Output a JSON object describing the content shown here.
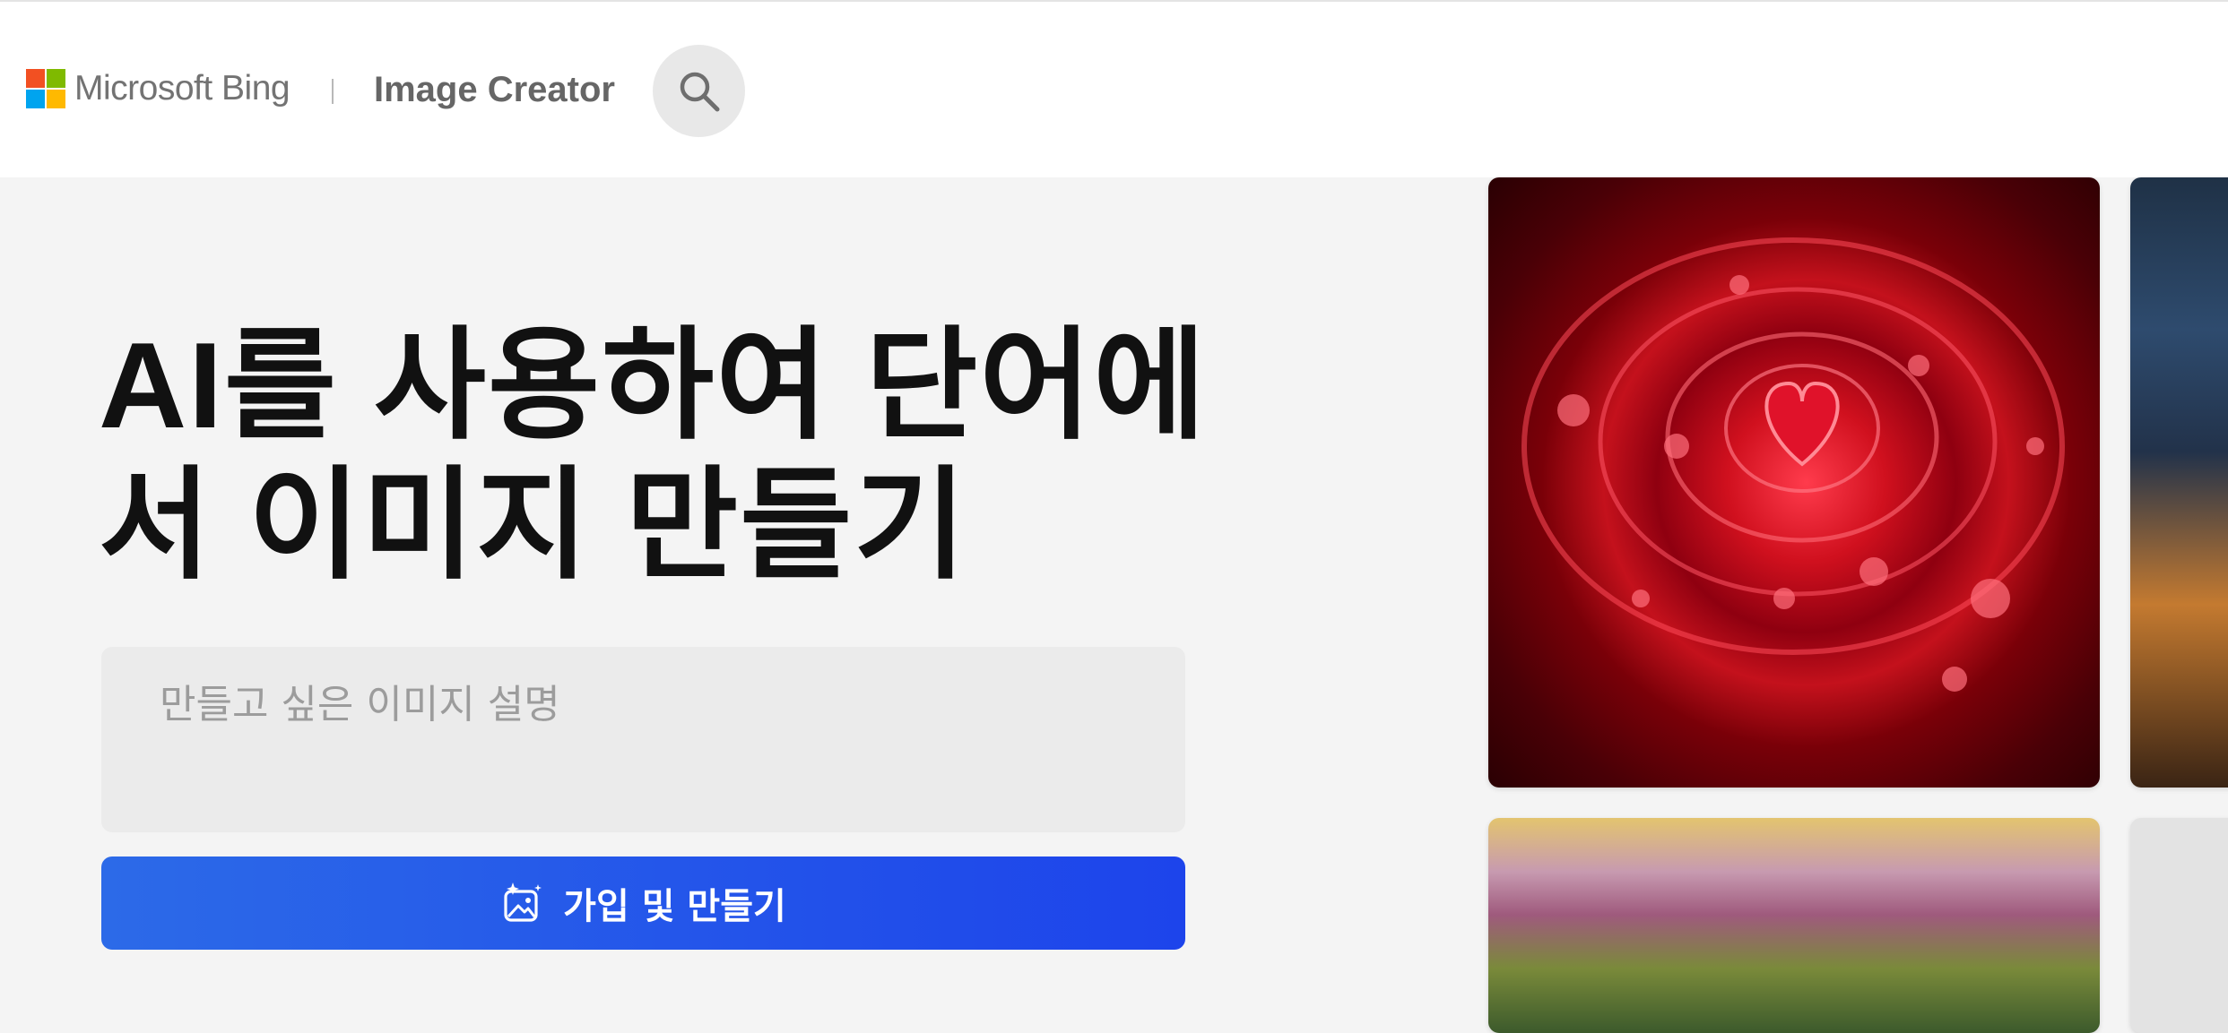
{
  "header": {
    "brand": "Microsoft Bing",
    "product_title": "Image Creator",
    "search_icon": "search-icon"
  },
  "hero": {
    "title": "AI를 사용하여 단어에서 이미지 만들기",
    "prompt_placeholder": "만들고 싶은 이미지 설명",
    "cta_label": "가입 및 만들기",
    "cta_icon": "sparkle-image-icon"
  },
  "colors": {
    "cta_gradient_start": "#2c6ae8",
    "cta_gradient_end": "#1d44eb",
    "ms_red": "#f25022",
    "ms_green": "#7fba00",
    "ms_blue": "#00a4ef",
    "ms_yellow": "#ffb900"
  }
}
